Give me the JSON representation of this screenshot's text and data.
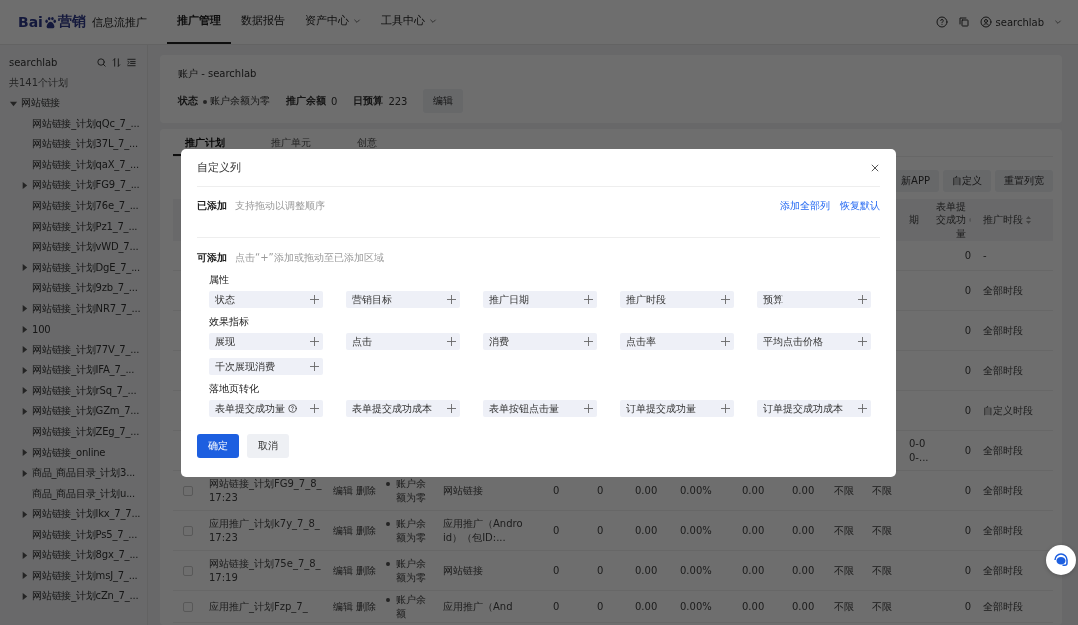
{
  "topbar": {
    "logo": {
      "latin": "Bai",
      "cjk": "营销"
    },
    "product": "信息流推广",
    "nav": [
      {
        "label": "推广管理",
        "selected": true,
        "dropdown": false
      },
      {
        "label": "数据报告",
        "selected": false,
        "dropdown": false
      },
      {
        "label": "资产中心",
        "selected": false,
        "dropdown": true
      },
      {
        "label": "工具中心",
        "selected": false,
        "dropdown": true
      }
    ],
    "user": "searchlab"
  },
  "sidebar": {
    "account": "searchlab",
    "count": "共141个计划",
    "tree": [
      {
        "label": "网站链接",
        "kind": "folder",
        "expanded": true,
        "children": [
          {
            "label": "网站链接_计划qQc_7_...",
            "kind": "leaf"
          },
          {
            "label": "网站链接_计划37L_7_...",
            "kind": "leaf"
          },
          {
            "label": "网站链接_计划qaX_7_...",
            "kind": "leaf"
          },
          {
            "label": "网站链接_计划FG9_7_...",
            "kind": "folder",
            "expanded": false
          },
          {
            "label": "网站链接_计划76e_7_...",
            "kind": "leaf"
          },
          {
            "label": "网站链接_计划Pz1_7_...",
            "kind": "leaf"
          },
          {
            "label": "网站链接_计划vWD_7...",
            "kind": "leaf"
          },
          {
            "label": "网站链接_计划DgE_7_...",
            "kind": "folder",
            "expanded": false
          },
          {
            "label": "网站链接_计划9zb_7_...",
            "kind": "leaf"
          },
          {
            "label": "网站链接_计划NR7_7_...",
            "kind": "folder",
            "expanded": false
          },
          {
            "label": "100",
            "kind": "folder",
            "expanded": false
          },
          {
            "label": "网站链接_计划77V_7_...",
            "kind": "folder",
            "expanded": false
          },
          {
            "label": "网站链接_计划IFA_7_...",
            "kind": "folder",
            "expanded": false
          },
          {
            "label": "网站链接_计划rSq_7_...",
            "kind": "folder",
            "expanded": false
          },
          {
            "label": "网站链接_计划GZm_7...",
            "kind": "folder",
            "expanded": false
          },
          {
            "label": "网站链接_计划ZEg_7_...",
            "kind": "leaf"
          },
          {
            "label": "网站链接_online",
            "kind": "folder",
            "expanded": false
          },
          {
            "label": "商品_商品目录_计划3...",
            "kind": "folder",
            "expanded": false
          },
          {
            "label": "商品_商品目录_计划u...",
            "kind": "leaf"
          },
          {
            "label": "网站链接_计划lkx_7_7...",
            "kind": "folder",
            "expanded": false
          },
          {
            "label": "网站链接_计划Ps5_7_...",
            "kind": "leaf"
          },
          {
            "label": "网站链接_计划8gx_7_...",
            "kind": "folder",
            "expanded": false
          },
          {
            "label": "网站链接_计划msJ_7_...",
            "kind": "folder",
            "expanded": false
          },
          {
            "label": "网站链接_计划cZn_7_...",
            "kind": "folder",
            "expanded": false
          }
        ]
      }
    ]
  },
  "account": {
    "title": "账户 - searchlab",
    "status_label": "状态",
    "status": "账户余额为零",
    "balance_label": "推广余额",
    "balance": "0",
    "budget_label": "日预算",
    "budget": "223",
    "edit": "编辑"
  },
  "tabs": [
    {
      "label": "推广计划",
      "selected": true
    },
    {
      "label": "推广单元",
      "selected": false
    },
    {
      "label": "创意",
      "selected": false
    }
  ],
  "toolbar": [
    "新APP",
    "自定义",
    "重置列宽"
  ],
  "table": {
    "columns": [
      {
        "label": "期",
        "sortable": false
      },
      {
        "label": "表单提交成功量",
        "sortable": true
      },
      {
        "label": "推广时段",
        "sortable": true
      }
    ],
    "rows": [
      {
        "count": "0",
        "period": "-"
      },
      {
        "count": "0",
        "period": "全部时段"
      },
      {
        "count": "0",
        "period": "全部时段"
      },
      {
        "count": "0",
        "period": "全部时段"
      },
      {
        "count": "0",
        "period": "自定义时段"
      },
      {
        "date": "0-0 0-...",
        "count": "0",
        "period": "全部时段"
      },
      {
        "checked": false,
        "name": "网站链接_计划FG9_7_8_17:23",
        "actions": [
          "编辑",
          "删除"
        ],
        "status": "账户余额为零",
        "type": "网站链接",
        "metrics": [
          "0",
          "0",
          "0.00",
          "0.00%",
          "0.00",
          "0.00",
          "不限",
          "不限"
        ],
        "count": "0",
        "period": "全部时段"
      },
      {
        "checked": false,
        "name": "应用推广_计划k7y_7_8_17:23",
        "actions": [
          "编辑",
          "删除"
        ],
        "status": "账户余额为零",
        "type": "应用推广（Android）（包ID:...",
        "metrics": [
          "0",
          "0",
          "0.00",
          "0.00%",
          "0.00",
          "0.00",
          "不限",
          "不限"
        ],
        "count": "0",
        "period": "全部时段"
      },
      {
        "checked": false,
        "name": "网站链接_计划75e_7_8_17:19",
        "actions": [
          "编辑",
          "删除"
        ],
        "status": "账户余额为零",
        "type": "网站链接",
        "metrics": [
          "0",
          "0",
          "0.00",
          "0.00%",
          "0.00",
          "0.00",
          "不限",
          "不限"
        ],
        "count": "0",
        "period": "全部时段"
      },
      {
        "checked": false,
        "name": "应用推广_计划Fzp_7_",
        "actions": [
          "编辑",
          "删除"
        ],
        "status": "账户余额",
        "type": "应用推广（And",
        "metrics": [
          "0",
          "0",
          "0.00",
          "0.00%",
          "0.00",
          "0.00",
          "不限",
          "不限"
        ],
        "count": "0",
        "period": "全部时段"
      }
    ]
  },
  "dialog": {
    "title": "自定义列",
    "added": {
      "label": "已添加",
      "hint": "支持拖动以调整顺序",
      "links": [
        "添加全部列",
        "恢复默认"
      ]
    },
    "available": {
      "label": "可添加",
      "hint": "点击“+”添加或拖动至已添加区域"
    },
    "groups": [
      {
        "title": "属性",
        "items": [
          {
            "label": "状态",
            "help": false
          },
          {
            "label": "营销目标",
            "help": false
          },
          {
            "label": "推广日期",
            "help": false
          },
          {
            "label": "推广时段",
            "help": false
          },
          {
            "label": "预算",
            "help": false
          }
        ]
      },
      {
        "title": "效果指标",
        "items": [
          {
            "label": "展现",
            "help": false
          },
          {
            "label": "点击",
            "help": false
          },
          {
            "label": "消费",
            "help": false
          },
          {
            "label": "点击率",
            "help": false
          },
          {
            "label": "平均点击价格",
            "help": false
          },
          {
            "label": "千次展现消费",
            "help": false
          }
        ]
      },
      {
        "title": "落地页转化",
        "items": [
          {
            "label": "表单提交成功量",
            "help": true
          },
          {
            "label": "表单提交成功成本",
            "help": false
          },
          {
            "label": "表单按钮点击量",
            "help": false
          },
          {
            "label": "订单提交成功量",
            "help": false
          },
          {
            "label": "订单提交成功成本",
            "help": false
          }
        ]
      }
    ],
    "buttons": [
      {
        "label": "确定",
        "kind": "primary"
      },
      {
        "label": "取消",
        "kind": "secondary"
      }
    ]
  }
}
